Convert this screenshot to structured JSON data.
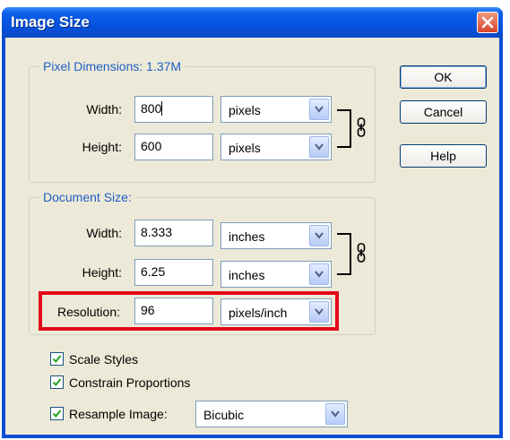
{
  "window": {
    "title": "Image Size"
  },
  "pixel_dimensions": {
    "title": "Pixel Dimensions: 1.37M",
    "width": {
      "label": "Width:",
      "value": "800",
      "unit": "pixels"
    },
    "height": {
      "label": "Height:",
      "value": "600",
      "unit": "pixels"
    }
  },
  "document_size": {
    "title": "Document Size:",
    "width": {
      "label": "Width:",
      "value": "8.333",
      "unit": "inches"
    },
    "height": {
      "label": "Height:",
      "value": "6.25",
      "unit": "inches"
    },
    "resolution": {
      "label": "Resolution:",
      "value": "96",
      "unit": "pixels/inch"
    }
  },
  "buttons": {
    "ok": "OK",
    "cancel": "Cancel",
    "help": "Help"
  },
  "options": {
    "scale_styles": {
      "label": "Scale Styles",
      "checked": true
    },
    "constrain_proportions": {
      "label": "Constrain Proportions",
      "checked": true
    },
    "resample_image": {
      "label": "Resample Image:",
      "checked": true,
      "method": "Bicubic"
    }
  },
  "colors": {
    "titlebar": "#0553df",
    "group_title": "#1f5fc7",
    "highlight": "#e4081b",
    "face": "#ece9d8"
  }
}
